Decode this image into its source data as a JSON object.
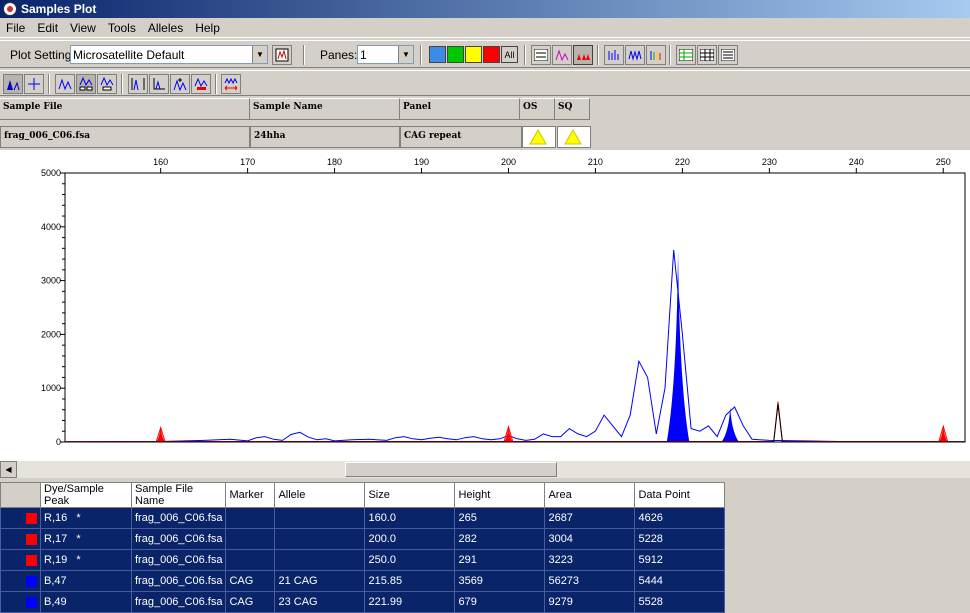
{
  "window": {
    "title": "Samples Plot"
  },
  "menu": [
    "File",
    "Edit",
    "View",
    "Tools",
    "Alleles",
    "Help"
  ],
  "toolbar": {
    "plot_setting_label": "Plot Setting:",
    "plot_setting_value": "Microsatellite Default",
    "panes_label": "Panes:",
    "panes_value": "1",
    "dye_buttons": [
      {
        "color": "#3c8ce6"
      },
      {
        "color": "#00c800"
      },
      {
        "color": "#ffff00"
      },
      {
        "color": "#ff0000"
      }
    ],
    "all_label": "All"
  },
  "sample_header": {
    "sample_file": "Sample File",
    "sample_name": "Sample Name",
    "panel": "Panel",
    "os": "OS",
    "sq": "SQ"
  },
  "sample_row": {
    "sample_file": "frag_006_C06.fsa",
    "sample_name": "24hha",
    "panel": "CAG repeat"
  },
  "chart_data": {
    "type": "line",
    "x_ticks": [
      160,
      170,
      180,
      190,
      200,
      210,
      220,
      230,
      240,
      250
    ],
    "y_ticks": [
      0,
      1000,
      2000,
      3000,
      4000,
      5000
    ],
    "xlim": [
      149,
      252.5
    ],
    "ylim": [
      0,
      5000
    ],
    "series": [
      {
        "color": "#0000ff",
        "points": [
          [
            149,
            5
          ],
          [
            160,
            10
          ],
          [
            165,
            30
          ],
          [
            168,
            50
          ],
          [
            170,
            20
          ],
          [
            171,
            80
          ],
          [
            172,
            100
          ],
          [
            173,
            50
          ],
          [
            174,
            30
          ],
          [
            175,
            140
          ],
          [
            176,
            180
          ],
          [
            177,
            90
          ],
          [
            178,
            40
          ],
          [
            179,
            60
          ],
          [
            180,
            20
          ],
          [
            182,
            40
          ],
          [
            184,
            50
          ],
          [
            186,
            30
          ],
          [
            187,
            80
          ],
          [
            188,
            100
          ],
          [
            189,
            60
          ],
          [
            190,
            40
          ],
          [
            191,
            70
          ],
          [
            192,
            90
          ],
          [
            193,
            60
          ],
          [
            194,
            40
          ],
          [
            195,
            80
          ],
          [
            196,
            100
          ],
          [
            197,
            60
          ],
          [
            198,
            40
          ],
          [
            199,
            60
          ],
          [
            200,
            120
          ],
          [
            201,
            60
          ],
          [
            202,
            30
          ],
          [
            203,
            50
          ],
          [
            204,
            150
          ],
          [
            205,
            100
          ],
          [
            206,
            100
          ],
          [
            207,
            250
          ],
          [
            208,
            150
          ],
          [
            209,
            100
          ],
          [
            210,
            200
          ],
          [
            211,
            500
          ],
          [
            212,
            300
          ],
          [
            213,
            100
          ],
          [
            214,
            500
          ],
          [
            215,
            1500
          ],
          [
            216,
            1200
          ],
          [
            217,
            150
          ],
          [
            218,
            1000
          ],
          [
            219,
            3569
          ],
          [
            220,
            2000
          ],
          [
            221,
            250
          ],
          [
            222,
            200
          ],
          [
            223,
            300
          ],
          [
            224,
            100
          ],
          [
            225,
            500
          ],
          [
            226,
            650
          ],
          [
            227,
            300
          ],
          [
            228,
            50
          ],
          [
            230,
            30
          ],
          [
            234,
            20
          ],
          [
            238,
            10
          ],
          [
            252.5,
            5
          ]
        ],
        "filled_peaks": [
          [
            218.2,
            220.8,
            3569
          ],
          [
            224.5,
            226.5,
            650
          ]
        ]
      },
      {
        "color": "#ff0000",
        "points": [
          [
            149,
            5
          ],
          [
            159.5,
            10
          ],
          [
            160,
            265
          ],
          [
            160.5,
            10
          ],
          [
            199.5,
            10
          ],
          [
            200,
            282
          ],
          [
            200.5,
            10
          ],
          [
            230.5,
            10
          ],
          [
            231,
            750
          ],
          [
            231.5,
            10
          ],
          [
            249.5,
            10
          ],
          [
            250,
            291
          ],
          [
            250.5,
            10
          ],
          [
            252.5,
            5
          ]
        ],
        "filled_peaks": [
          [
            159.5,
            160.5,
            265
          ],
          [
            199.5,
            200.5,
            282
          ],
          [
            249.5,
            250.5,
            291
          ]
        ]
      },
      {
        "color": "#000000",
        "points": [
          [
            149,
            2
          ],
          [
            230.5,
            2
          ],
          [
            231,
            700
          ],
          [
            231.5,
            2
          ],
          [
            252.5,
            2
          ]
        ],
        "filled_peaks": []
      }
    ]
  },
  "peaks_table": {
    "headers": [
      "",
      "Dye/Sample Peak",
      "Sample File Name",
      "Marker",
      "Allele",
      "Size",
      "Height",
      "Area",
      "Data Point"
    ],
    "rows": [
      {
        "color": "#ff0000",
        "peak": "R,16   *",
        "file": "frag_006_C06.fsa",
        "marker": "",
        "allele": "",
        "size": "160.0",
        "height": "265",
        "area": "2687",
        "data_point": "4626"
      },
      {
        "color": "#ff0000",
        "peak": "R,17   *",
        "file": "frag_006_C06.fsa",
        "marker": "",
        "allele": "",
        "size": "200.0",
        "height": "282",
        "area": "3004",
        "data_point": "5228"
      },
      {
        "color": "#ff0000",
        "peak": "R,19   *",
        "file": "frag_006_C06.fsa",
        "marker": "",
        "allele": "",
        "size": "250.0",
        "height": "291",
        "area": "3223",
        "data_point": "5912"
      },
      {
        "color": "#0000ff",
        "peak": "B,47",
        "file": "frag_006_C06.fsa",
        "marker": "CAG",
        "allele": "21 CAG",
        "size": "215.85",
        "height": "3569",
        "area": "56273",
        "data_point": "5444"
      },
      {
        "color": "#0000ff",
        "peak": "B,49",
        "file": "frag_006_C06.fsa",
        "marker": "CAG",
        "allele": "23 CAG",
        "size": "221.99",
        "height": "679",
        "area": "9279",
        "data_point": "5528"
      }
    ]
  }
}
